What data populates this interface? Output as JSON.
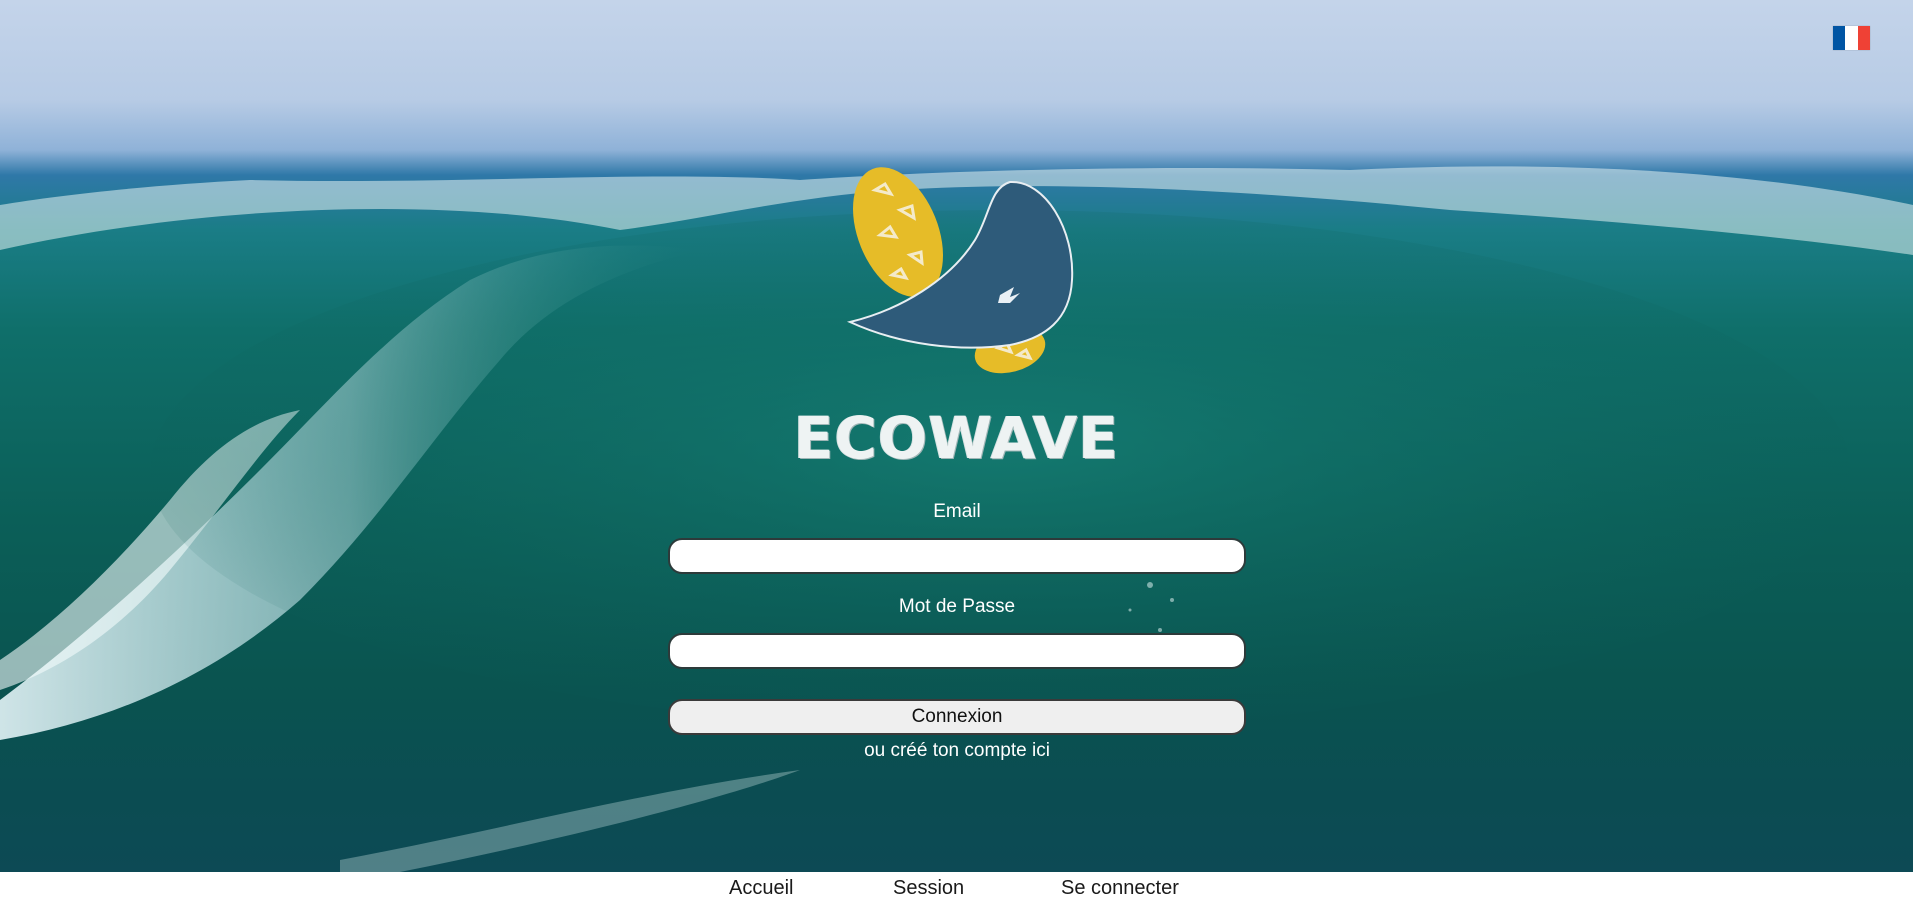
{
  "colors": {
    "flag_blue": "#0055a4",
    "flag_white": "#ffffff",
    "flag_red": "#ef4135",
    "logo_yellow": "#e6bc28",
    "logo_navy": "#2e5b7a"
  },
  "icons": {
    "language": "france-flag-icon",
    "logo": "ecowave-surfboards-logo"
  },
  "brand": {
    "name": "ECOWAVE"
  },
  "form": {
    "email_label": "Email",
    "email_value": "",
    "password_label": "Mot de Passe",
    "password_value": "",
    "submit_label": "Connexion",
    "create_account_text": "ou créé ton compte ici"
  },
  "nav": {
    "items": [
      {
        "label": "Accueil"
      },
      {
        "label": "Session"
      },
      {
        "label": "Se connecter"
      }
    ]
  }
}
